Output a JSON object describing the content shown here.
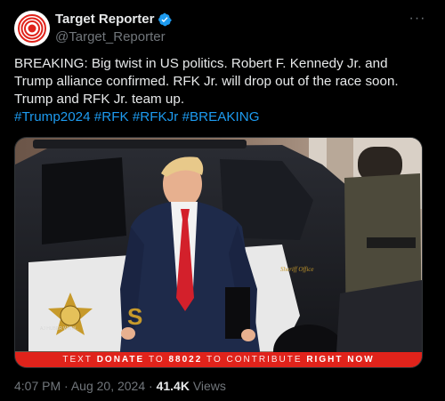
{
  "account": {
    "display_name": "Target Reporter",
    "handle": "@Target_Reporter",
    "verified_icon": "verified-badge-icon",
    "avatar_icon": "target-logo-icon"
  },
  "menu": {
    "more_icon": "more-options-icon",
    "more_label": "···"
  },
  "post": {
    "lines": [
      "BREAKING: Big twist in US politics. Robert F. Kennedy Jr. and",
      "Trump alliance confirmed. RFK Jr. will drop out of the race soon.",
      "Trump and RFK Jr. team up."
    ],
    "hashtags": [
      "#Trump2024",
      "#RFK",
      "#RFKJr",
      "#BREAKING"
    ]
  },
  "media": {
    "banner": {
      "text_1": "TEXT",
      "bold_1": "DONATE",
      "text_2": "TO",
      "bold_2": "88022",
      "text_3": "TO CONTRIBUTE",
      "bold_3": "RIGHT NOW"
    },
    "door_lettering": "Sheriff Office",
    "car_letters": "S",
    "watermark": "AJ HUBER WWW.."
  },
  "meta": {
    "time": "4:07 PM",
    "separator": "·",
    "date": "Aug 20, 2024",
    "views_count": "41.4K",
    "views_label": "Views"
  },
  "colors": {
    "background": "#000000",
    "text": "#e7e9ea",
    "secondary": "#71767b",
    "link": "#1d9bf0",
    "banner": "#e0231b"
  }
}
